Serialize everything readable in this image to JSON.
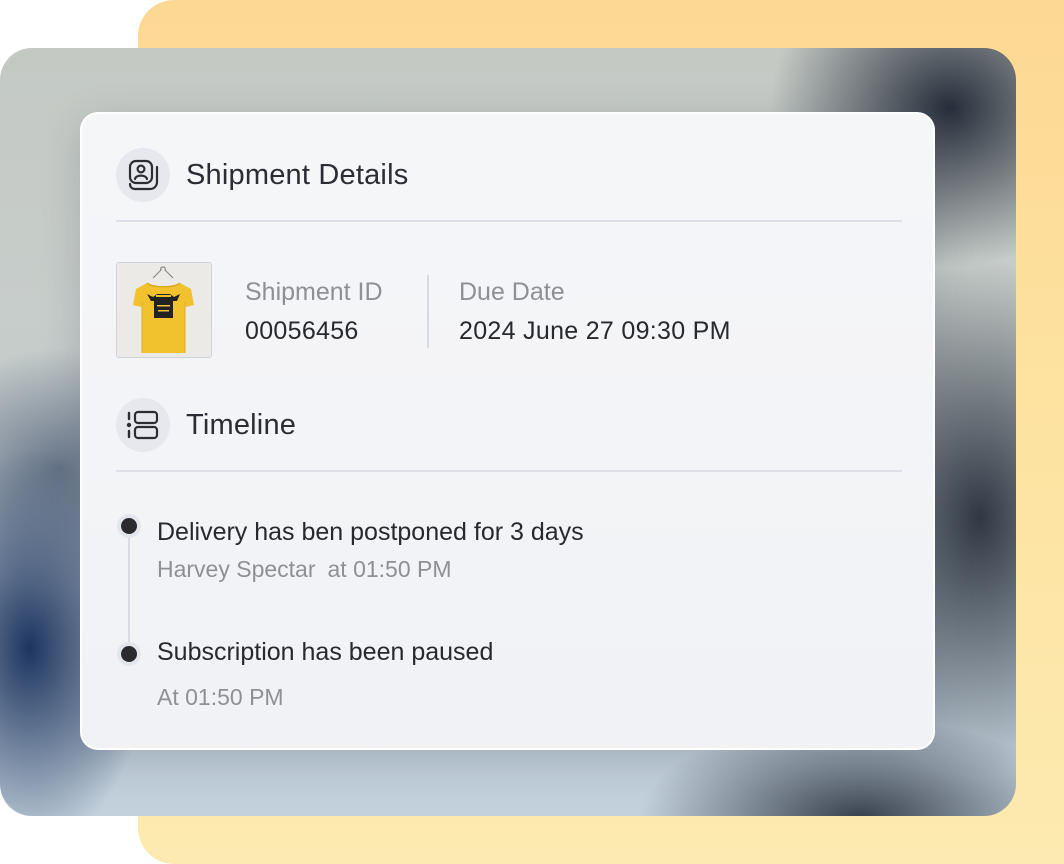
{
  "colors": {
    "backdrop_yellow": "#fdd892",
    "card_background": "#f4f5f7",
    "primary_text": "#27292e",
    "secondary_text": "#8e9096",
    "timeline_dot": "#2b2b2f",
    "tshirt": "#f2c12e"
  },
  "shipment": {
    "icon": "package-icon",
    "title": "Shipment Details",
    "product_image": "yellow-tshirt-image",
    "id_label": "Shipment ID",
    "id_value": "00056456",
    "due_label": "Due Date",
    "due_value": "2024 June 27 09:30 PM"
  },
  "timeline": {
    "icon": "timeline-list-icon",
    "title": "Timeline",
    "events": [
      {
        "title": "Delivery has ben postponed for 3 days",
        "author": "Harvey Spectar",
        "time": "at 01:50 PM"
      },
      {
        "title": "Subscription has been paused",
        "time": "At 01:50 PM"
      }
    ]
  }
}
